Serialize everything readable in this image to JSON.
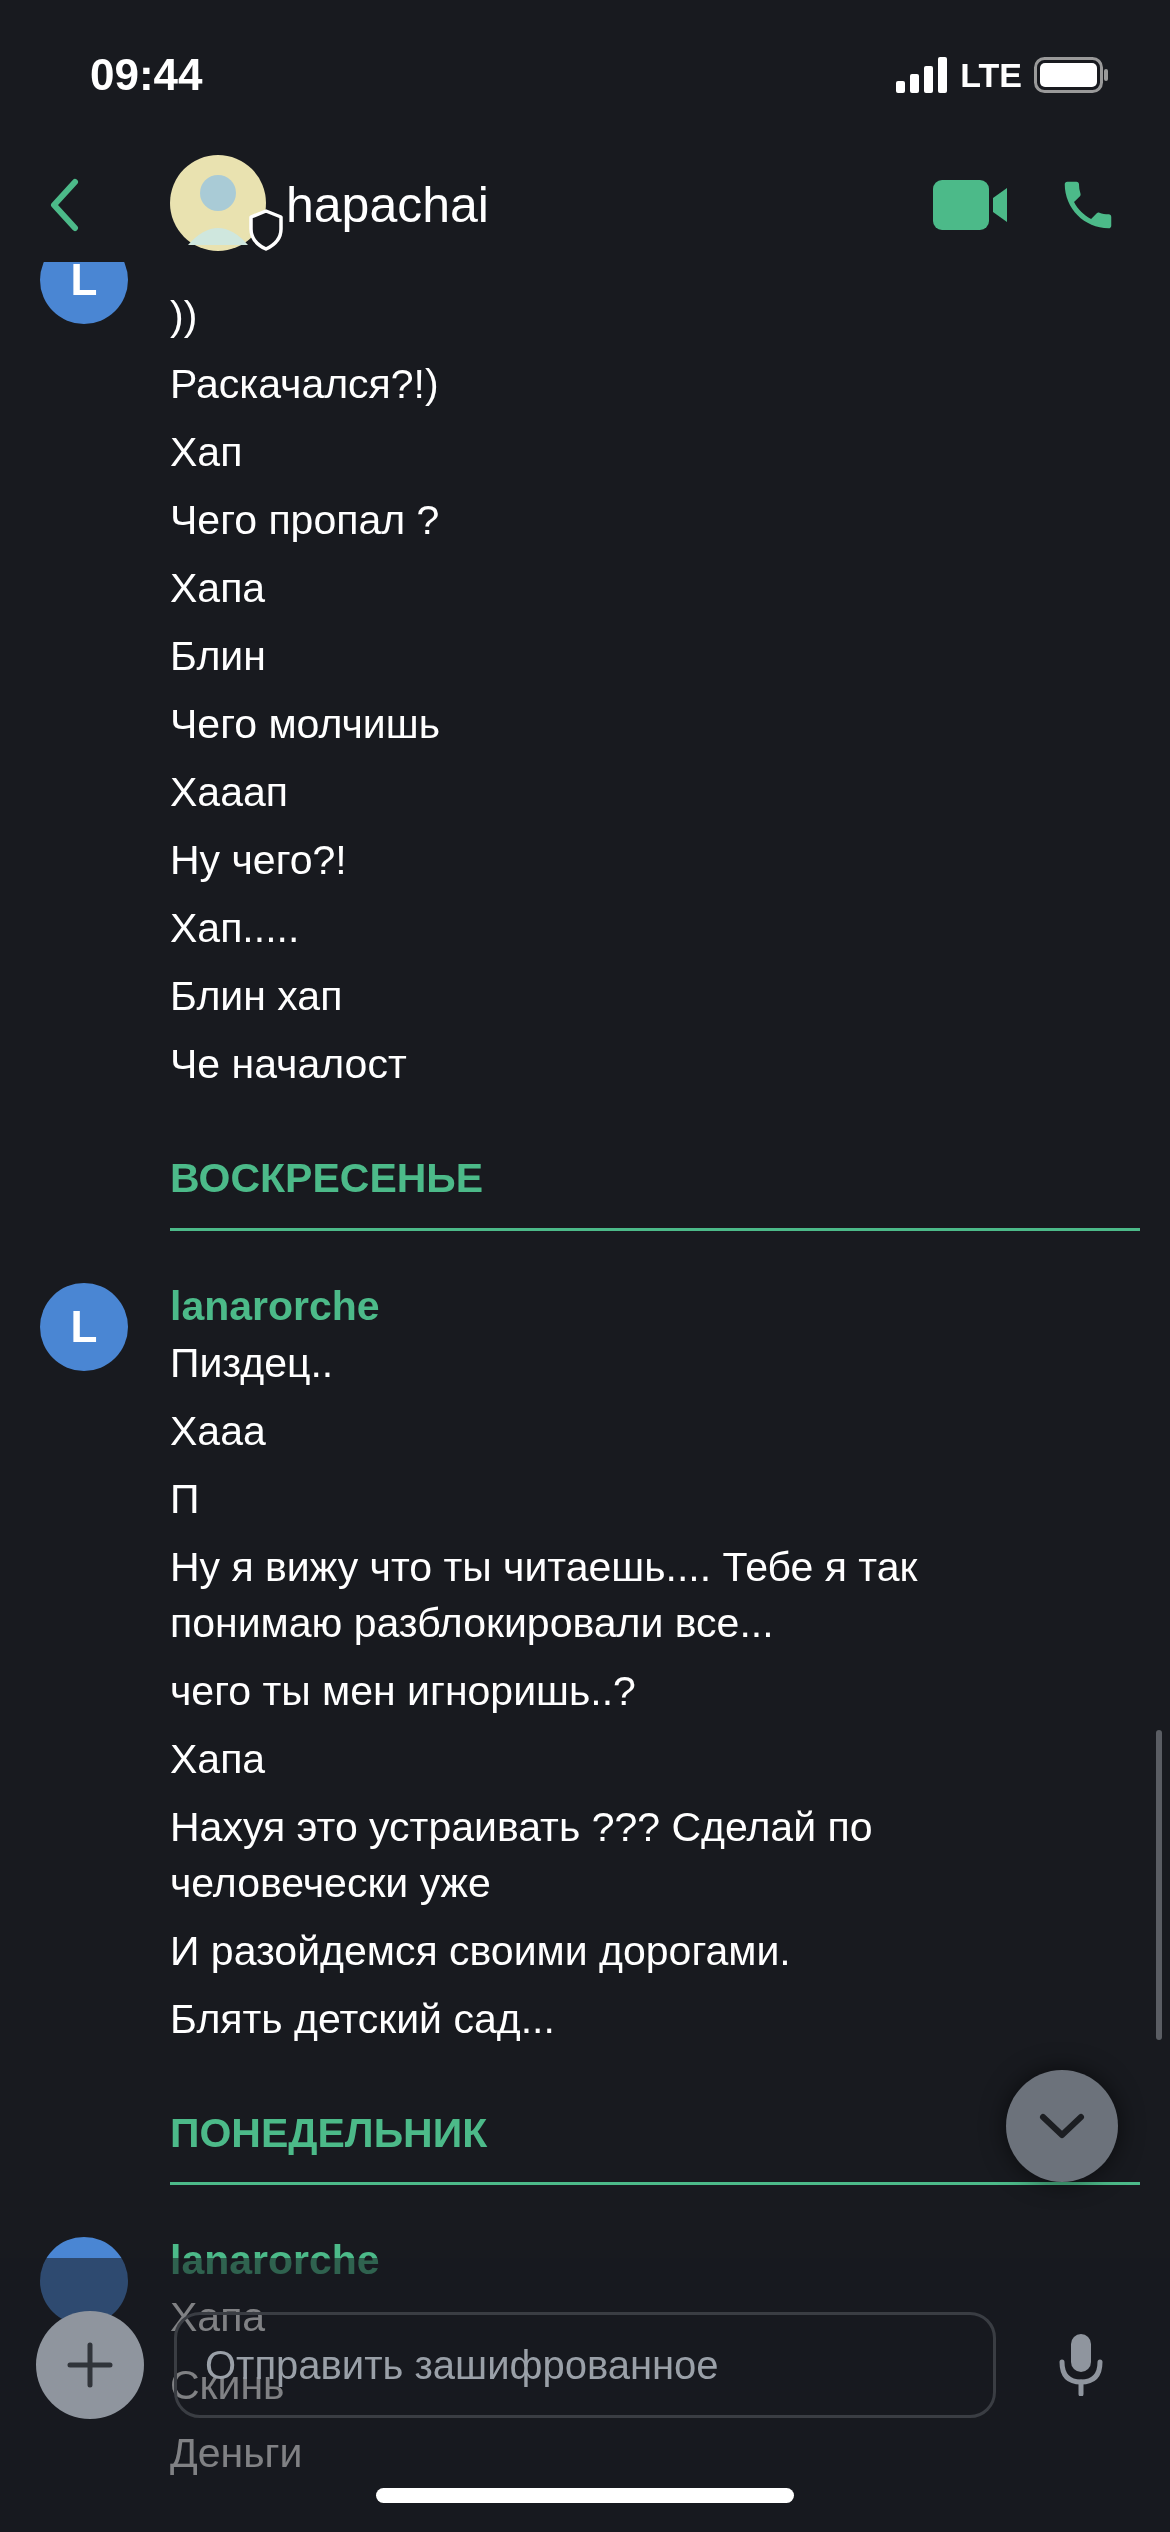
{
  "status_bar": {
    "time": "09:44",
    "network": "LTE"
  },
  "header": {
    "contact": "hapachai"
  },
  "feed": [
    {
      "kind": "group",
      "avatar_letter": "L",
      "messages": [
        "))",
        "Раскачался?!)",
        "Хап",
        "Чего пропал ?",
        "Хапа",
        "Блин",
        "Чего молчишь",
        "Хааап",
        "Ну чего?!",
        "Хап.....",
        "Блин хап",
        "Че началост"
      ]
    },
    {
      "kind": "divider",
      "label": "ВОСКРЕСЕНЬЕ"
    },
    {
      "kind": "group",
      "avatar_letter": "L",
      "sender": "lanarorche",
      "messages": [
        "Пиздец..",
        "Хааа",
        "П",
        "Ну я вижу что ты читаешь.... Тебе я так понимаю разблокировали все...",
        "чего ты мен игноришь..?",
        "Хапа",
        "Нахуя это устраивать ??? Сделай по человечески уже",
        "И разойдемся своими дорогами.",
        "Блять детский сад..."
      ]
    },
    {
      "kind": "divider",
      "label": "ПОНЕДЕЛЬНИК"
    },
    {
      "kind": "group",
      "sender": "lanarorche",
      "messages": [
        "Хапа",
        "Скинь",
        "Деньги"
      ]
    }
  ],
  "composer": {
    "placeholder": "Отправить зашифрованное"
  }
}
